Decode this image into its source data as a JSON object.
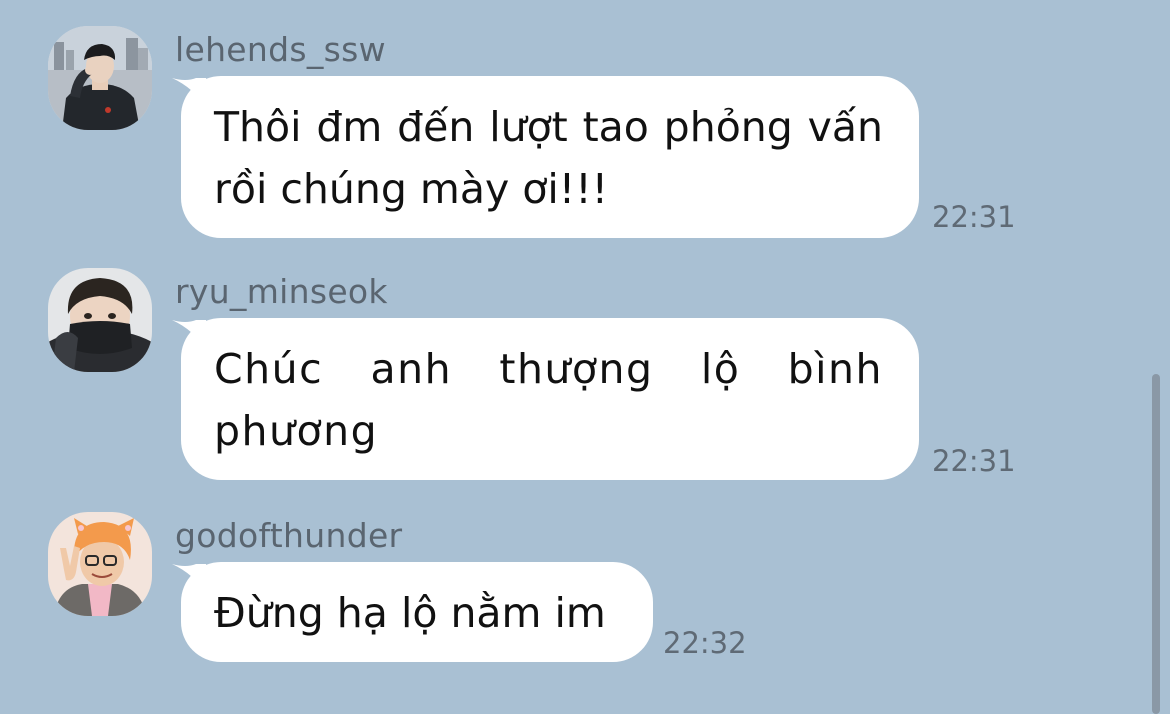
{
  "messages": [
    {
      "username": "lehends_ssw",
      "text": "Thôi đm đến lượt tao phỏng vấn rồi chúng mày ơi!!!",
      "time": "22:31",
      "avatar": "person-dark-jacket-avatar"
    },
    {
      "username": "ryu_minseok",
      "text": "Chúc anh thượng lộ bình phương",
      "time": "22:31",
      "avatar": "person-face-mask-avatar"
    },
    {
      "username": "godofthunder",
      "text": "Đừng hạ lộ nằm im",
      "time": "22:32",
      "avatar": "person-orange-hat-peace-sign-avatar"
    }
  ],
  "colors": {
    "background": "#a9c0d3",
    "bubble": "#ffffff",
    "username": "#5a6570",
    "timestamp": "#5f6a75",
    "message_text": "#111111"
  }
}
